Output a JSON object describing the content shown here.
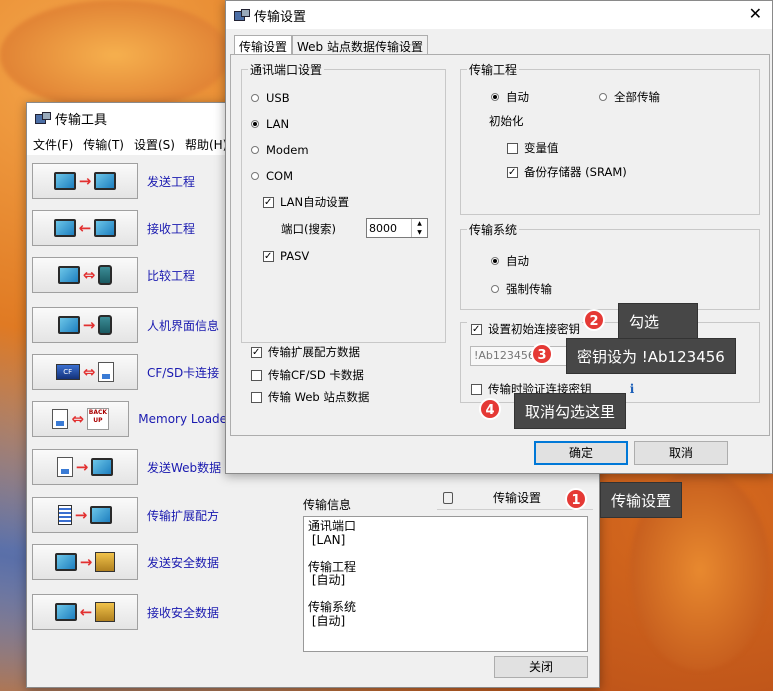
{
  "tool_window": {
    "title": "传输工具",
    "menu": [
      "文件(F)",
      "传输(T)",
      "设置(S)",
      "帮助(H)"
    ],
    "items": [
      {
        "label": "发送工程",
        "left_icon": "monitor-icon",
        "arrow": "→",
        "right_icon": "screen-icon"
      },
      {
        "label": "接收工程",
        "left_icon": "monitor-icon",
        "arrow": "←",
        "right_icon": "screen-icon"
      },
      {
        "label": "比较工程",
        "left_icon": "screen-icon",
        "arrow": "⇔",
        "right_icon": "monitor-icon"
      },
      {
        "label": "人机界面信息",
        "left_icon": "screen-icon",
        "arrow": "→",
        "right_icon": "monitor-icon"
      },
      {
        "label": "CF/SD卡连接",
        "left_icon": "card-icon",
        "arrow": "⇔",
        "right_icon": "file-icon"
      },
      {
        "label": "Memory Loader",
        "left_icon": "file-icon",
        "arrow": "⇔",
        "right_icon": "backup-icon"
      },
      {
        "label": "发送Web数据",
        "left_icon": "file-icon",
        "arrow": "→",
        "right_icon": "screen-icon"
      },
      {
        "label": "传输扩展配方",
        "left_icon": "list-icon",
        "arrow": "→",
        "right_icon": "screen-icon"
      },
      {
        "label": "发送安全数据",
        "left_icon": "monitor-icon",
        "arrow": "→",
        "right_icon": "safe-icon"
      },
      {
        "label": "接收安全数据",
        "left_icon": "monitor-icon",
        "arrow": "←",
        "right_icon": "safe-icon"
      }
    ],
    "backup_text": "BACK UP",
    "card_text": "CF",
    "info_label": "传输信息",
    "settings_button": "传输设置",
    "info_text": "通讯端口\n [LAN]\n\n传输工程\n [自动]\n\n传输系统\n [自动]",
    "close_button": "关闭"
  },
  "settings_window": {
    "title": "传输设置",
    "close": "✕",
    "tabs": [
      "传输设置",
      "Web 站点数据传输设置"
    ],
    "port_group": {
      "legend": "通讯端口设置",
      "options": [
        "USB",
        "LAN",
        "Modem",
        "COM"
      ],
      "selected": "LAN",
      "lan_auto_label": "LAN自动设置",
      "port_label": "端口(搜索)",
      "port_value": "8000",
      "pasv_label": "PASV"
    },
    "data_checks": [
      {
        "label": "传输扩展配方数据",
        "checked": true
      },
      {
        "label": "传输CF/SD 卡数据",
        "checked": false
      },
      {
        "label": "传输 Web 站点数据",
        "checked": false
      }
    ],
    "project_group": {
      "legend": "传输工程",
      "auto_label": "自动",
      "all_label": "全部传输",
      "init_label": "初始化",
      "var_label": "变量值",
      "backup_label": "备份存储器 (SRAM)"
    },
    "system_group": {
      "legend": "传输系统",
      "auto_label": "自动",
      "force_label": "强制传输"
    },
    "key_group": {
      "legend": "设置初始连接密钥",
      "key_value": "!Ab123456",
      "verify_label": "传输时验证连接密钥",
      "info_icon": "i"
    },
    "ok_button": "确定",
    "cancel_button": "取消"
  },
  "callouts": [
    {
      "num": "1",
      "text": "传输设置"
    },
    {
      "num": "2",
      "text": "勾选"
    },
    {
      "num": "3",
      "text": "密钥设为 !Ab123456"
    },
    {
      "num": "4",
      "text": "取消勾选这里"
    }
  ]
}
